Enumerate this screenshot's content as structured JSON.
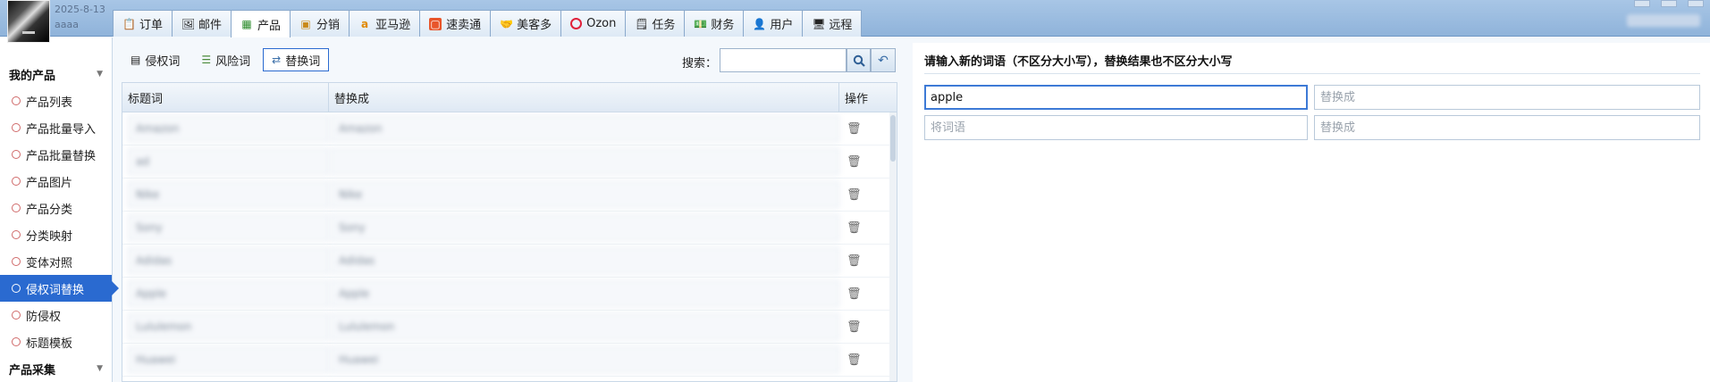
{
  "header": {
    "date": "2025-8-13",
    "user": "aaaa",
    "tabs": [
      {
        "label": "订单",
        "icon": "order-icon"
      },
      {
        "label": "邮件",
        "icon": "mail-icon"
      },
      {
        "label": "产品",
        "icon": "product-icon",
        "active": true
      },
      {
        "label": "分销",
        "icon": "distribution-icon"
      },
      {
        "label": "亚马逊",
        "icon": "amazon-icon"
      },
      {
        "label": "速卖通",
        "icon": "aliexpress-icon"
      },
      {
        "label": "美客多",
        "icon": "mercadolibre-icon"
      },
      {
        "label": "Ozon",
        "icon": "ozon-icon"
      },
      {
        "label": "任务",
        "icon": "task-icon"
      },
      {
        "label": "财务",
        "icon": "finance-icon"
      },
      {
        "label": "用户",
        "icon": "user-icon"
      },
      {
        "label": "远程",
        "icon": "remote-icon"
      }
    ]
  },
  "sidebar": {
    "section_title": "我的产品",
    "items": [
      {
        "label": "产品列表"
      },
      {
        "label": "产品批量导入"
      },
      {
        "label": "产品批量替换"
      },
      {
        "label": "产品图片"
      },
      {
        "label": "产品分类"
      },
      {
        "label": "分类映射"
      },
      {
        "label": "变体对照"
      },
      {
        "label": "侵权词替换",
        "active": true
      },
      {
        "label": "防侵权"
      },
      {
        "label": "标题模板"
      }
    ],
    "section2_title": "产品采集"
  },
  "main": {
    "subtabs": [
      {
        "label": "侵权词"
      },
      {
        "label": "风险词"
      },
      {
        "label": "替换词",
        "active": true
      }
    ],
    "search_label": "搜索：",
    "columns": [
      "标题词",
      "替换成",
      "操作"
    ],
    "rows": [
      {
        "word": "Amazon",
        "replace": "Amazon"
      },
      {
        "word": "ad",
        "replace": ""
      },
      {
        "word": "Nike",
        "replace": "Nike"
      },
      {
        "word": "Sony",
        "replace": "Sony"
      },
      {
        "word": "Adidas",
        "replace": "Adidas"
      },
      {
        "word": "Apple",
        "replace": "Apple"
      },
      {
        "word": "Lululemon",
        "replace": "Lululemon"
      },
      {
        "word": "Huawei",
        "replace": "Huawei"
      }
    ]
  },
  "right": {
    "title": "请输入新的词语（不区分大小写），替换结果也不区分大小写",
    "row1_word": "apple",
    "row1_replace_placeholder": "替换成",
    "row2_word_placeholder": "将词语",
    "row2_replace_placeholder": "替换成"
  },
  "colors": {
    "accent": "#2a6ad0",
    "header": "#a8c6e6"
  }
}
